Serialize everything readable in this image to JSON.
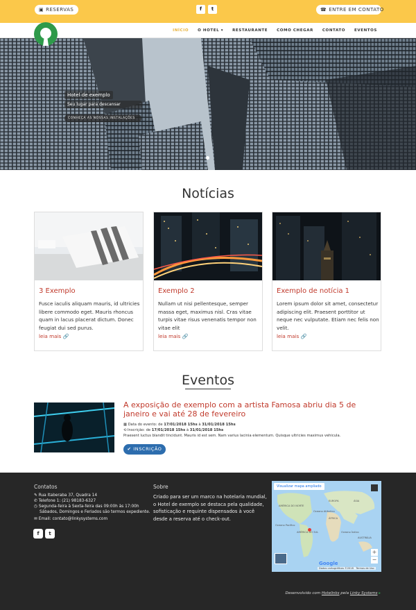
{
  "topbar": {
    "reservas_label": "RESERVAS",
    "contact_label": "ENTRE EM CONTATO",
    "social": [
      "facebook-icon",
      "twitter-icon"
    ]
  },
  "nav": {
    "items": [
      "INÍCIO",
      "O HOTEL ▾",
      "RESTAURANTE",
      "COMO CHEGAR",
      "CONTATO",
      "EVENTOS"
    ],
    "active_color": "#e8b23a"
  },
  "hero": {
    "caption_title": "Hotel de exemplo",
    "caption_sub": "Seu lugar para descansar",
    "caption_button": "CONHEÇA AS NOSSAS INSTALAÇÕES"
  },
  "news": {
    "heading": "Notícias",
    "more_label": "leia mais",
    "cards": [
      {
        "title": "3 Exemplo",
        "body": "Fusce iaculis aliquam mauris, id ultricies libere commodo eget. Mauris rhoncus quam in lacus placerat dictum. Donec feugiat dui sed purus."
      },
      {
        "title": "Exemplo 2",
        "body": "Nullam ut nisi pellentesque, semper massa eget, maximus nisl. Cras vitae turpis vitae risus venenatis tempor non vitae elit"
      },
      {
        "title": "Exemplo de notícia 1",
        "body": "Lorem ipsum dolor sit amet, consectetur adipiscing elit. Praesent porttitor ut neque nec vulputate. Etiam nec felis non velit."
      }
    ]
  },
  "events": {
    "heading": "Eventos",
    "title": "A exposição de exemplo com a artista Famosa abriu dia 5 de janeiro e vai até 28 de fevereiro",
    "event_label": "Data do evento: de",
    "event_from": "17/01/2018 15hs",
    "event_mid": "à",
    "event_to": "31/01/2018 15hs",
    "signup_label": "Inscrição: de",
    "signup_from": "17/01/2018 15hs",
    "signup_mid": "à",
    "signup_to": "31/01/2018 15hs",
    "description": "Praesent luctus blandit tincidunt. Mauris id est sem. Nam varius lacinia elementum. Quisque ultricies maximus vehicula.",
    "button": "INSCRIÇÃO"
  },
  "footer": {
    "contacts_heading": "Contatos",
    "address": "Rua Itaberaba 37, Quadra 14",
    "phone": "Telefone 1: (21) 98183-6327",
    "hours_1": "Segunda-feira à Sexta-feira das 09:00h às 17:00h",
    "hours_2": "Sábados, Domingos e Feriados são termos expediente.",
    "email": "Email: contato@linkysystems.com",
    "about_heading": "Sobre",
    "about_text": "Criado para ser um marco na hotelaria mundial, o Hotel de exemplo se destaca pela qualidade, sofisticação e requinte dispensados à você desde a reserva até o check-out.",
    "map": {
      "button": "Visualizar mapa ampliado",
      "labels": [
        "AMÉRICA DO NORTE",
        "Oceano Atlântico",
        "ÁFRICA",
        "EUROPA",
        "ÁSIA",
        "AMÉRICA DO SUL",
        "Oceano Pacífico",
        "Oceano Índico",
        "AUSTRÁLIA"
      ],
      "zoom_in": "+",
      "zoom_out": "−",
      "google": "Google",
      "attribution": "Dados cartográficos ©2018",
      "terms": "Termos de Uso"
    },
    "credit_prefix": "Desenvolvido com",
    "credit_tool": "Hotelinks",
    "credit_mid": "pela",
    "credit_company": "Linky Systems"
  }
}
